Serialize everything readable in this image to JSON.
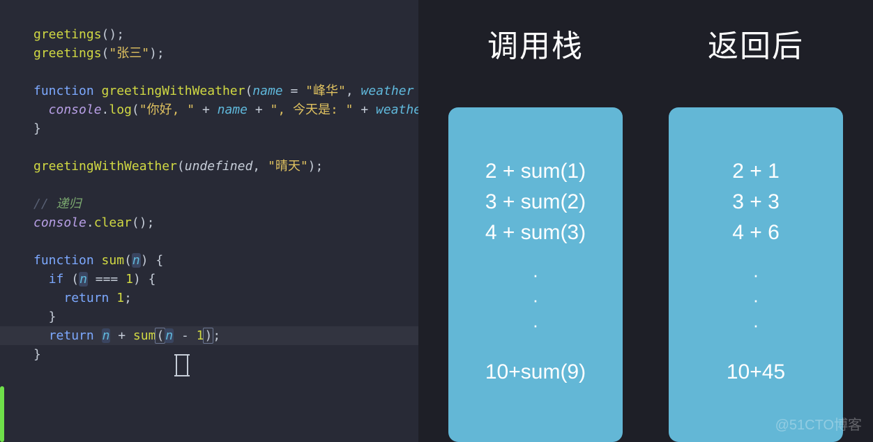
{
  "code": {
    "l1a": "greetings",
    "l1b": "();",
    "l2a": "greetings",
    "l2b": "(",
    "l2c": "\"张三\"",
    "l2d": ");",
    "l4a": "function ",
    "l4b": "greetingWithWeather",
    "l4c": "(",
    "l4d": "name",
    "l4e": " = ",
    "l4f": "\"峰华\"",
    "l4g": ", ",
    "l4h": "weather",
    "l5a": "  console",
    "l5b": ".",
    "l5c": "log",
    "l5d": "(",
    "l5e": "\"你好, \"",
    "l5f": " + ",
    "l5g": "name",
    "l5h": " + ",
    "l5i": "\", 今天是: \"",
    "l5j": " + ",
    "l5k": "weathe",
    "l6a": "}",
    "l8a": "greetingWithWeather",
    "l8b": "(",
    "l8c": "undefined",
    "l8d": ", ",
    "l8e": "\"晴天\"",
    "l8f": ");",
    "l10a": "// ",
    "l10b": "递归",
    "l11a": "console",
    "l11b": ".",
    "l11c": "clear",
    "l11d": "();",
    "l13a": "function ",
    "l13b": "sum",
    "l13c": "(",
    "l13d": "n",
    "l13e": ") {",
    "l14a": "  ",
    "l14b": "if",
    "l14c": " (",
    "l14d": "n",
    "l14e": " === ",
    "l14f": "1",
    "l14g": ") {",
    "l15a": "    ",
    "l15b": "return",
    "l15c": " ",
    "l15d": "1",
    "l15e": ";",
    "l16a": "  }",
    "l17a": "  ",
    "l17b": "return",
    "l17c": " ",
    "l17d": "n",
    "l17e": " + ",
    "l17f": "sum",
    "l17g": "(",
    "l17h": "n",
    "l17i": " - ",
    "l17j": "1",
    "l17k": ")",
    "l17l": ";",
    "l18a": "}"
  },
  "diagram": {
    "left_title": "调用栈",
    "right_title": "返回后",
    "stack": [
      "2 + sum(1)",
      "3 + sum(2)",
      "4 + sum(3)"
    ],
    "stack_last": "10+sum(9)",
    "result": [
      "2 + 1",
      "3 + 3",
      "4 + 6"
    ],
    "result_last": "10+45",
    "dot": "·"
  },
  "watermark": "@51CTO博客"
}
